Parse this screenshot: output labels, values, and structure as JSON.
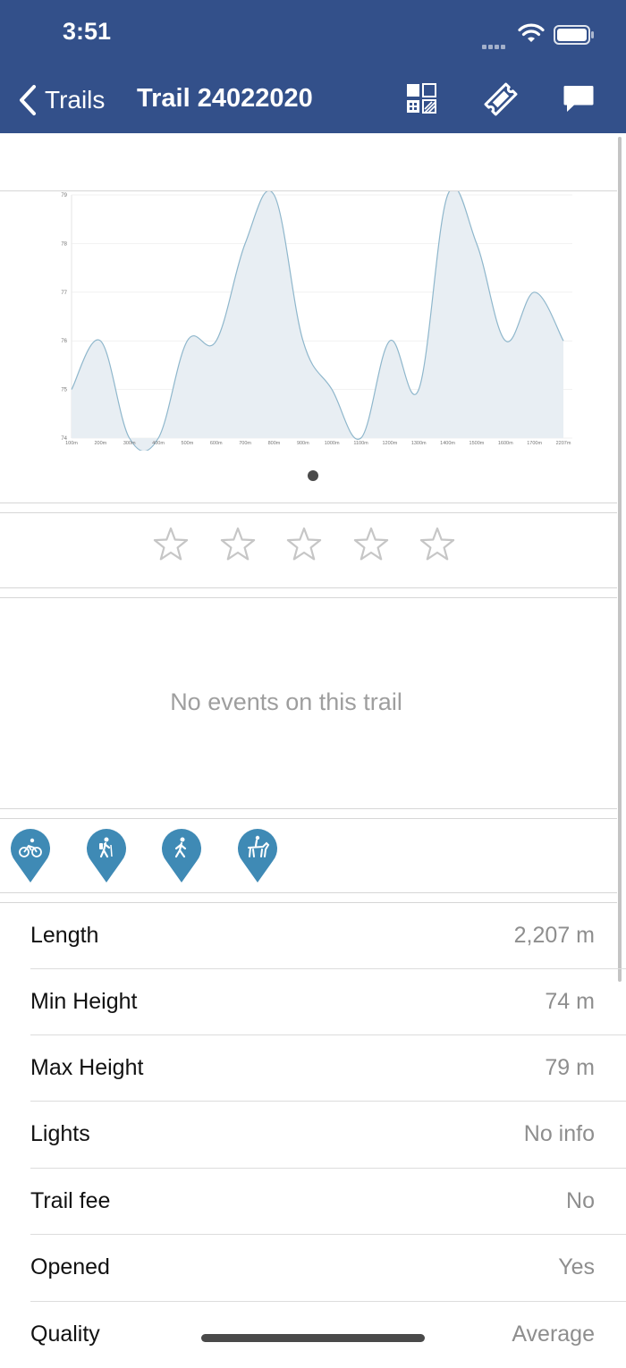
{
  "status_bar": {
    "time": "3:51"
  },
  "nav": {
    "back_label": "Trails",
    "title": "Trail 24022020",
    "icons": [
      "qr-code-icon",
      "ticket-icon",
      "chat-bubble-icon"
    ]
  },
  "chart_data": {
    "type": "area",
    "title": "",
    "xlabel": "",
    "ylabel": "",
    "x_ticks": [
      "100m",
      "200m",
      "300m",
      "400m",
      "500m",
      "600m",
      "700m",
      "800m",
      "900m",
      "1000m",
      "1100m",
      "1200m",
      "1300m",
      "1400m",
      "1500m",
      "1600m",
      "1700m",
      "2207m"
    ],
    "y_ticks": [
      74,
      75,
      76,
      77,
      78,
      79
    ],
    "ylim": [
      74,
      79
    ],
    "grid": true,
    "legend": "none",
    "series": [
      {
        "values": [
          75,
          76,
          74,
          74,
          76,
          76,
          78,
          79,
          76,
          75,
          74,
          76,
          75,
          79,
          78,
          76,
          77,
          76
        ]
      }
    ],
    "colors": {
      "fill": "#e8eef3",
      "line": "#8fb7cc"
    }
  },
  "rating": {
    "stars": 5,
    "filled": 0
  },
  "events": {
    "empty_text": "No events on this trail"
  },
  "activities": [
    {
      "name": "cycling-icon"
    },
    {
      "name": "hiking-icon"
    },
    {
      "name": "walking-icon"
    },
    {
      "name": "horse-riding-icon"
    }
  ],
  "info": [
    {
      "label": "Length",
      "value": "2,207 m"
    },
    {
      "label": "Min Height",
      "value": "74 m"
    },
    {
      "label": "Max Height",
      "value": "79 m"
    },
    {
      "label": "Lights",
      "value": "No info"
    },
    {
      "label": "Trail fee",
      "value": "No"
    },
    {
      "label": "Opened",
      "value": "Yes"
    },
    {
      "label": "Quality",
      "value": "Average"
    }
  ],
  "colors": {
    "header": "#33508a",
    "pin": "#3f8ab5",
    "star_outline": "#c6c6c6"
  }
}
